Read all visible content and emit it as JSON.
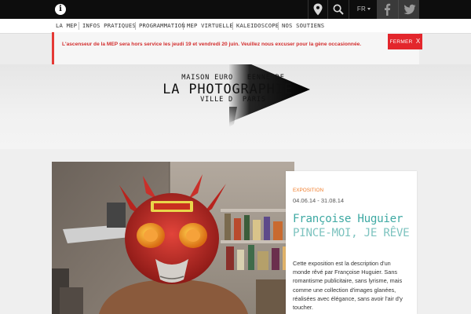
{
  "topbar": {
    "info_icon": "info-icon",
    "location_icon": "map-pin-icon",
    "search_icon": "search-icon",
    "language": "FR",
    "facebook_icon": "facebook-icon",
    "twitter_icon": "twitter-icon"
  },
  "nav": {
    "items": [
      {
        "label": "LA MEP"
      },
      {
        "label": "INFOS PRATIQUES"
      },
      {
        "label": "PROGRAMMATION"
      },
      {
        "label": "MEP VIRTUELLE"
      },
      {
        "label": "KALEIDOSCOPE"
      },
      {
        "label": "NOS SOUTIENS"
      }
    ]
  },
  "alert": {
    "message": "L'ascenseur de la MEP sera hors service les jeudi 19 et vendredi 20 juin. Veuillez nous excuser pour la gène occasionnée.",
    "close_label": "FERMER",
    "close_glyph": "X"
  },
  "logo": {
    "line1": "MAISON EURO   EENNE DE",
    "line2": "LA PHOTOGRAPHIE",
    "line3": "VILLE D  PARIS"
  },
  "feature": {
    "category": "EXPOSITION",
    "dates": "04.06.14 - 31.08.14",
    "title": "Françoise Huguier",
    "subtitle": "PINCE-MOI, JE RÊVE",
    "description": "Cette exposition est la description d'un monde rêvé par Françoise Huguier. Sans romantisme publicitaire, sans lyrisme, mais comme une collection d'images glanées, réalisées avec élégance, sans avoir l'air d'y toucher."
  },
  "colors": {
    "accent_red": "#e3262c",
    "teal_title": "#3ea9a3",
    "orange_category": "#f07c2a"
  }
}
